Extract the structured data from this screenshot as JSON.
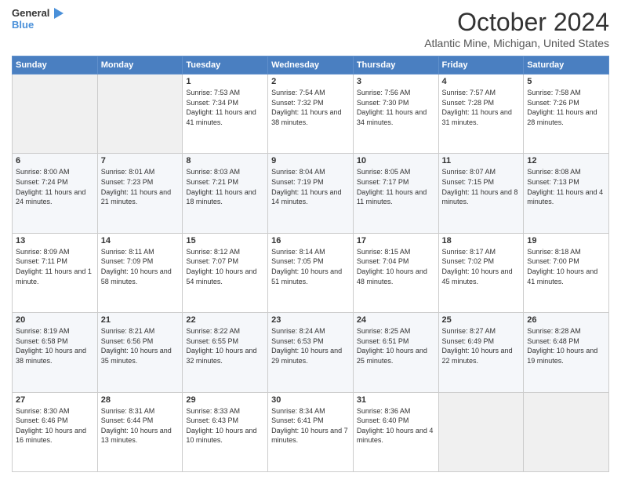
{
  "header": {
    "logo_line1": "General",
    "logo_line2": "Blue",
    "month": "October 2024",
    "location": "Atlantic Mine, Michigan, United States"
  },
  "weekdays": [
    "Sunday",
    "Monday",
    "Tuesday",
    "Wednesday",
    "Thursday",
    "Friday",
    "Saturday"
  ],
  "weeks": [
    [
      {
        "day": "",
        "content": ""
      },
      {
        "day": "",
        "content": ""
      },
      {
        "day": "1",
        "content": "Sunrise: 7:53 AM\nSunset: 7:34 PM\nDaylight: 11 hours and 41 minutes."
      },
      {
        "day": "2",
        "content": "Sunrise: 7:54 AM\nSunset: 7:32 PM\nDaylight: 11 hours and 38 minutes."
      },
      {
        "day": "3",
        "content": "Sunrise: 7:56 AM\nSunset: 7:30 PM\nDaylight: 11 hours and 34 minutes."
      },
      {
        "day": "4",
        "content": "Sunrise: 7:57 AM\nSunset: 7:28 PM\nDaylight: 11 hours and 31 minutes."
      },
      {
        "day": "5",
        "content": "Sunrise: 7:58 AM\nSunset: 7:26 PM\nDaylight: 11 hours and 28 minutes."
      }
    ],
    [
      {
        "day": "6",
        "content": "Sunrise: 8:00 AM\nSunset: 7:24 PM\nDaylight: 11 hours and 24 minutes."
      },
      {
        "day": "7",
        "content": "Sunrise: 8:01 AM\nSunset: 7:23 PM\nDaylight: 11 hours and 21 minutes."
      },
      {
        "day": "8",
        "content": "Sunrise: 8:03 AM\nSunset: 7:21 PM\nDaylight: 11 hours and 18 minutes."
      },
      {
        "day": "9",
        "content": "Sunrise: 8:04 AM\nSunset: 7:19 PM\nDaylight: 11 hours and 14 minutes."
      },
      {
        "day": "10",
        "content": "Sunrise: 8:05 AM\nSunset: 7:17 PM\nDaylight: 11 hours and 11 minutes."
      },
      {
        "day": "11",
        "content": "Sunrise: 8:07 AM\nSunset: 7:15 PM\nDaylight: 11 hours and 8 minutes."
      },
      {
        "day": "12",
        "content": "Sunrise: 8:08 AM\nSunset: 7:13 PM\nDaylight: 11 hours and 4 minutes."
      }
    ],
    [
      {
        "day": "13",
        "content": "Sunrise: 8:09 AM\nSunset: 7:11 PM\nDaylight: 11 hours and 1 minute."
      },
      {
        "day": "14",
        "content": "Sunrise: 8:11 AM\nSunset: 7:09 PM\nDaylight: 10 hours and 58 minutes."
      },
      {
        "day": "15",
        "content": "Sunrise: 8:12 AM\nSunset: 7:07 PM\nDaylight: 10 hours and 54 minutes."
      },
      {
        "day": "16",
        "content": "Sunrise: 8:14 AM\nSunset: 7:05 PM\nDaylight: 10 hours and 51 minutes."
      },
      {
        "day": "17",
        "content": "Sunrise: 8:15 AM\nSunset: 7:04 PM\nDaylight: 10 hours and 48 minutes."
      },
      {
        "day": "18",
        "content": "Sunrise: 8:17 AM\nSunset: 7:02 PM\nDaylight: 10 hours and 45 minutes."
      },
      {
        "day": "19",
        "content": "Sunrise: 8:18 AM\nSunset: 7:00 PM\nDaylight: 10 hours and 41 minutes."
      }
    ],
    [
      {
        "day": "20",
        "content": "Sunrise: 8:19 AM\nSunset: 6:58 PM\nDaylight: 10 hours and 38 minutes."
      },
      {
        "day": "21",
        "content": "Sunrise: 8:21 AM\nSunset: 6:56 PM\nDaylight: 10 hours and 35 minutes."
      },
      {
        "day": "22",
        "content": "Sunrise: 8:22 AM\nSunset: 6:55 PM\nDaylight: 10 hours and 32 minutes."
      },
      {
        "day": "23",
        "content": "Sunrise: 8:24 AM\nSunset: 6:53 PM\nDaylight: 10 hours and 29 minutes."
      },
      {
        "day": "24",
        "content": "Sunrise: 8:25 AM\nSunset: 6:51 PM\nDaylight: 10 hours and 25 minutes."
      },
      {
        "day": "25",
        "content": "Sunrise: 8:27 AM\nSunset: 6:49 PM\nDaylight: 10 hours and 22 minutes."
      },
      {
        "day": "26",
        "content": "Sunrise: 8:28 AM\nSunset: 6:48 PM\nDaylight: 10 hours and 19 minutes."
      }
    ],
    [
      {
        "day": "27",
        "content": "Sunrise: 8:30 AM\nSunset: 6:46 PM\nDaylight: 10 hours and 16 minutes."
      },
      {
        "day": "28",
        "content": "Sunrise: 8:31 AM\nSunset: 6:44 PM\nDaylight: 10 hours and 13 minutes."
      },
      {
        "day": "29",
        "content": "Sunrise: 8:33 AM\nSunset: 6:43 PM\nDaylight: 10 hours and 10 minutes."
      },
      {
        "day": "30",
        "content": "Sunrise: 8:34 AM\nSunset: 6:41 PM\nDaylight: 10 hours and 7 minutes."
      },
      {
        "day": "31",
        "content": "Sunrise: 8:36 AM\nSunset: 6:40 PM\nDaylight: 10 hours and 4 minutes."
      },
      {
        "day": "",
        "content": ""
      },
      {
        "day": "",
        "content": ""
      }
    ]
  ]
}
